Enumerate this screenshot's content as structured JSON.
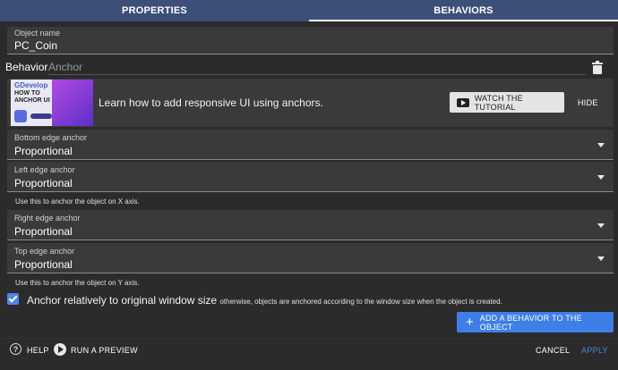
{
  "tabs": [
    {
      "label": "PROPERTIES",
      "active": false
    },
    {
      "label": "BEHAVIORS",
      "active": true
    }
  ],
  "object_name": {
    "label": "Object name",
    "value": "PC_Coin"
  },
  "behavior": {
    "title": "Behavior",
    "name": "Anchor"
  },
  "tutorial": {
    "thumb_line1": "GDevelop",
    "thumb_line2": "HOW TO ANCHOR UI",
    "text": "Learn how to add responsive UI using anchors.",
    "watch_label": "WATCH THE TUTORIAL",
    "hide_label": "HIDE"
  },
  "dropdowns": {
    "bottom": {
      "label": "Bottom edge anchor",
      "value": "Proportional"
    },
    "left": {
      "label": "Left edge anchor",
      "value": "Proportional"
    },
    "right": {
      "label": "Right edge anchor",
      "value": "Proportional"
    },
    "top": {
      "label": "Top edge anchor",
      "value": "Proportional"
    }
  },
  "helpers": {
    "x": "Use this to anchor the object on X axis.",
    "y": "Use this to anchor the object on Y axis."
  },
  "checkbox": {
    "checked": true,
    "label": "Anchor relatively to original window size",
    "sub": "otherwise, objects are anchored according to the window size when the object is created."
  },
  "add_button": {
    "label": "ADD A BEHAVIOR TO THE OBJECT"
  },
  "footer": {
    "help": "HELP",
    "preview": "RUN A PREVIEW",
    "cancel": "CANCEL",
    "apply": "APPLY"
  },
  "colors": {
    "tab_bar": "#3c4f78",
    "accent": "#4a86e8",
    "background": "#2b2b2b",
    "field": "#3a3a3a"
  }
}
